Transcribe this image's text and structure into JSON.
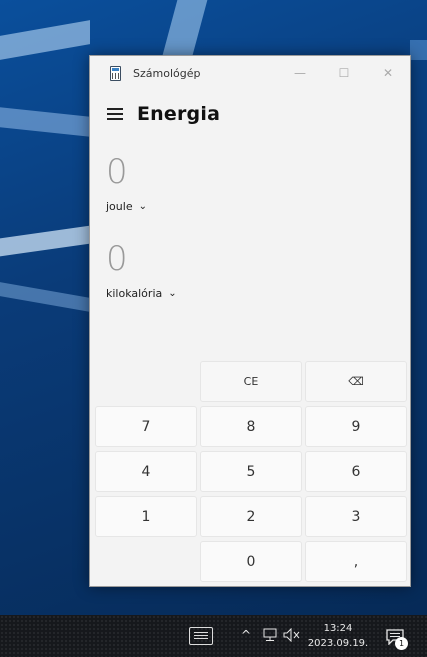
{
  "window": {
    "title": "Számológép",
    "minimize_icon": "—",
    "maximize_icon": "☐",
    "close_icon": "✕"
  },
  "header": {
    "mode_title": "Energia"
  },
  "input": {
    "value": "0",
    "unit": "joule"
  },
  "output": {
    "value": "0",
    "unit": "kilokalória"
  },
  "keypad": {
    "ce": "CE",
    "backspace": "⌫",
    "rows": [
      [
        "7",
        "8",
        "9"
      ],
      [
        "4",
        "5",
        "6"
      ],
      [
        "1",
        "2",
        "3"
      ]
    ],
    "zero": "0",
    "decimal": ","
  },
  "taskbar": {
    "time": "13:24",
    "date": "2023.09.19.",
    "notification_count": "1",
    "chevron": "^",
    "volume_icon": "🔈"
  },
  "colors": {
    "window_bg": "#f3f3f3",
    "key_bg": "#fafafa",
    "taskbar_bg": "#16181c",
    "wallpaper": "#0a4f9c"
  }
}
